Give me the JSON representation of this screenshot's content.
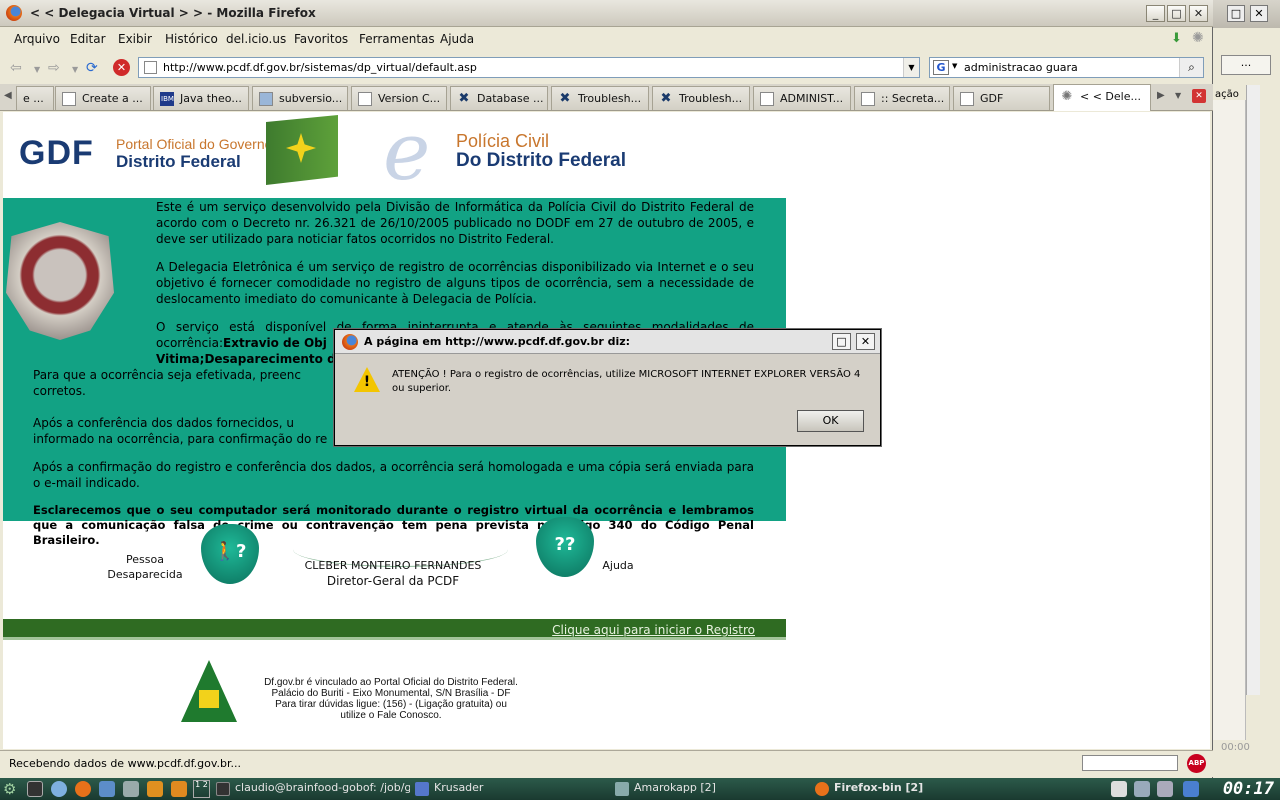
{
  "window": {
    "title": "< < Delegacia Virtual > > - Mozilla Firefox"
  },
  "menu": [
    "Arquivo",
    "Editar",
    "Exibir",
    "Histórico",
    "del.icio.us",
    "Favoritos",
    "Ferramentas",
    "Ajuda"
  ],
  "address": {
    "url": "http://www.pcdf.df.gov.br/sistemas/dp_virtual/default.asp"
  },
  "search": {
    "value": "administracao guara",
    "engine": "G"
  },
  "tabs": [
    "e ...",
    "Create a ...",
    "Java theo...",
    "subversio...",
    "Version C...",
    "Database ...",
    "Troublesh...",
    "Troublesh...",
    "ADMINIST...",
    "::  Secreta...",
    "GDF",
    "< < Dele..."
  ],
  "page": {
    "gdf": "GDF",
    "portal_line1": "Portal Oficial do Governo do",
    "portal_line2": "Distrito Federal",
    "pc_line1": "Polícia Civil",
    "pc_line2": "Do Distrito Federal",
    "p1": "Este é um serviço desenvolvido pela Divisão de Informática da Polícia Civil do Distrito Federal de acordo com o Decreto nr. 26.321 de 26/10/2005 publicado no DODF em 27 de outubro de 2005, e deve ser utilizado para noticiar fatos ocorridos no Distrito Federal.",
    "p2": "A Delegacia Eletrônica é um serviço de registro de ocorrências disponibilizado via Internet e o seu objetivo é fornecer comodidade no registro de alguns tipos de ocorrência, sem a necessidade de deslocamento imediato do comunicante à Delegacia de Polícia.",
    "p3_a": "O serviço está disponível de forma ininterrupta e atende às seguintes modalidades de ocorrência:",
    "p3_b": "Extravio de Obj",
    "p3_c": "Vitima",
    "p3_d": ";Desaparecimento de",
    "p4": "Para que a ocorrência seja efetivada, preenc",
    "p4b": "corretos.",
    "p5": "Após a conferência dos dados fornecidos, u",
    "p5b": "informado na ocorrência, para confirmação do re",
    "p6": "Após a confirmação do registro e conferência dos dados, a ocorrência será homologada e uma cópia será enviada para o e-mail indicado.",
    "p7": "Esclarecemos que o seu computador será monitorado durante o registro virtual da ocorrência e lembramos que a comunicação falsa de crime ou contravenção tem pena prevista no artigo 340 do Código Penal Brasileiro.",
    "pessoa": "Pessoa",
    "desaparecida": "Desaparecida",
    "director_name": "CLEBER MONTEIRO FERNANDES",
    "director_title": "Diretor-Geral da PCDF",
    "ajuda": "Ajuda",
    "register_link": "Clique aqui para iniciar o Registro",
    "foot1": "Df.gov.br é vinculado ao Portal Oficial do  Distrito Federal.",
    "foot2": "Palácio do Buriti - Eixo Monumental, S/N Brasília - DF",
    "foot3": "Para tirar dúvidas ligue: (156) - (Ligação gratuita) ou",
    "foot4": "utilize o Fale Conosco."
  },
  "dialog": {
    "title": "A página em http://www.pcdf.df.gov.br diz:",
    "message": "ATENÇÃO ! Para o registro de ocorrências, utilize MICROSOFT INTERNET EXPLORER VERSÃO 4 ou superior.",
    "ok": "OK"
  },
  "status": {
    "text": "Recebendo dados de www.pcdf.df.gov.br...",
    "abp": "ABP"
  },
  "background_window": {
    "menu_fragment": "ação",
    "button": "...",
    "time": "00:00"
  },
  "taskbar": {
    "tasks": [
      "claudio@brainfood-gobof: /job/gob",
      "Krusader",
      "Amarokapp [2]",
      "Firefox-bin [2]"
    ],
    "clock": "00:17",
    "pager": "1 2"
  }
}
